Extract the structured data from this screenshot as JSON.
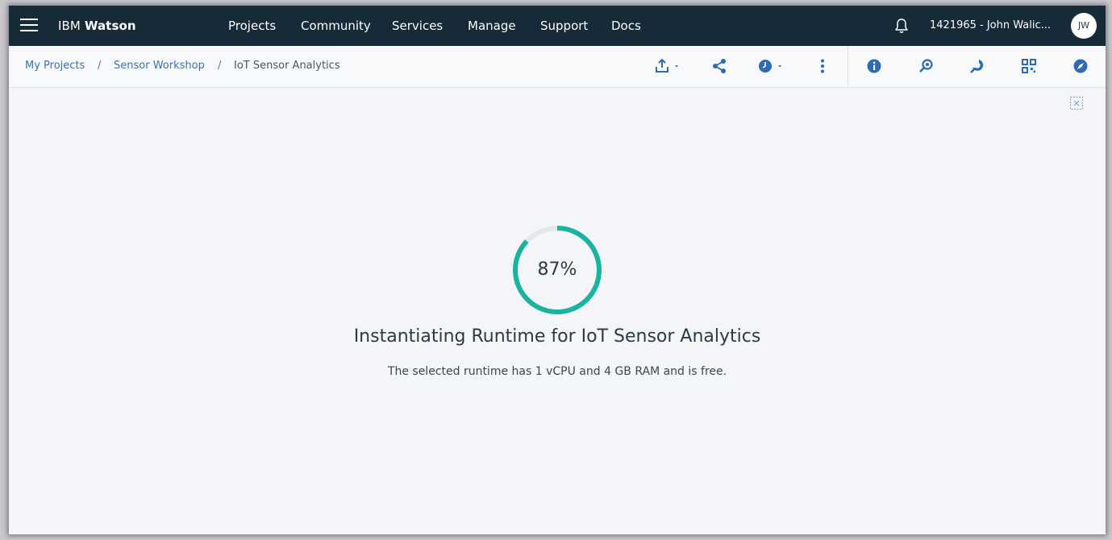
{
  "brand": {
    "prefix": "IBM",
    "name": "Watson"
  },
  "nav": {
    "items": [
      {
        "label": "Projects"
      },
      {
        "label": "Community"
      },
      {
        "label": "Services"
      },
      {
        "label": "Manage"
      },
      {
        "label": "Support"
      },
      {
        "label": "Docs"
      }
    ]
  },
  "account": {
    "label": "1421965 - John Walic...",
    "initials": "JW"
  },
  "breadcrumb": {
    "items": [
      {
        "label": "My Projects"
      },
      {
        "label": "Sensor Workshop"
      },
      {
        "label": "IoT Sensor Analytics"
      }
    ],
    "separator": "/"
  },
  "toolbar": {
    "icons": [
      "export-icon",
      "share-icon",
      "schedule-icon",
      "more-options-icon",
      "info-icon",
      "find-replace-icon",
      "data-icon",
      "assets-icon",
      "explore-icon"
    ],
    "accent": "#2f6ab2"
  },
  "loading": {
    "percent_label": "87%",
    "progress": 0.87,
    "ring_color": "#1ab39f",
    "title": "Instantiating Runtime for IoT Sensor Analytics",
    "description": "The selected runtime has 1 vCPU and 4 GB RAM and is free."
  }
}
